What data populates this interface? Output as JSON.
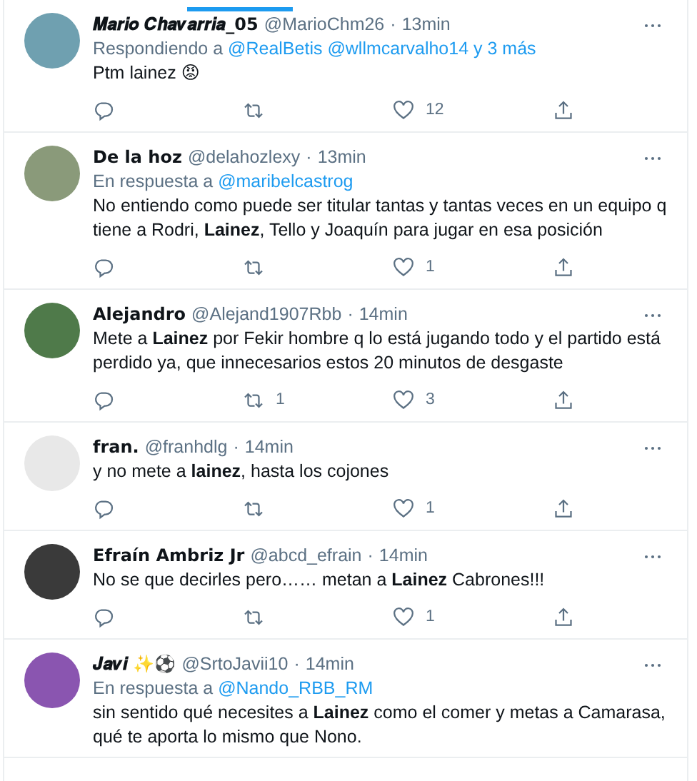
{
  "tweets": [
    {
      "name": "𝑴𝒂𝒓𝒊𝒐 𝑪𝒉𝒂𝒗𝒂𝒓𝒓𝒊𝒂_05",
      "handle": "@MarioChm26",
      "separator": "·",
      "time": "13min",
      "reply": {
        "prefix": "Respondiendo a",
        "links": [
          "@RealBetis",
          "@wllmcarvalho14",
          "y 3 más"
        ]
      },
      "text": "Ptm lainez 😡",
      "counts": {
        "like": "12"
      }
    },
    {
      "name": "De la hoz",
      "handle": "@delahozlexy",
      "separator": "·",
      "time": "13min",
      "reply": {
        "prefix": "En respuesta a",
        "links": [
          "@maribelcastrog"
        ]
      },
      "text": "No entiendo como puede ser titular tantas y tantas veces en un equipo q tiene a Rodri, **Lainez**, Tello y Joaquín para jugar en esa posición",
      "counts": {
        "like": "1"
      }
    },
    {
      "name": "Alejandro",
      "handle": "@Alejand1907Rbb",
      "separator": "·",
      "time": "14min",
      "text": "Mete a **Lainez** por Fekir hombre q lo está jugando todo y el partido está perdido ya, que innecesarios estos 20 minutos de desgaste",
      "counts": {
        "retweet": "1",
        "like": "3"
      }
    },
    {
      "name": "fran.",
      "handle": "@franhdlg",
      "separator": "·",
      "time": "14min",
      "text": "y no mete a **lainez**, hasta los cojones",
      "counts": {
        "like": "1"
      }
    },
    {
      "name": "Efraín Ambriz Jr",
      "handle": "@abcd_efrain",
      "separator": "·",
      "time": "14min",
      "text": "No se que decirles pero…… metan a **Lainez** Cabrones!!!",
      "counts": {
        "like": "1"
      }
    },
    {
      "name": "𝑱𝒂𝒗𝒊 ✨⚽",
      "handle": "@SrtoJavii10",
      "separator": "·",
      "time": "14min",
      "reply": {
        "prefix": "En respuesta a",
        "links": [
          "@Nando_RBB_RM"
        ]
      },
      "text": "sin sentido qué necesites a **Lainez** como el comer y metas a Camarasa, qué te aporta lo mismo que Nono."
    }
  ]
}
